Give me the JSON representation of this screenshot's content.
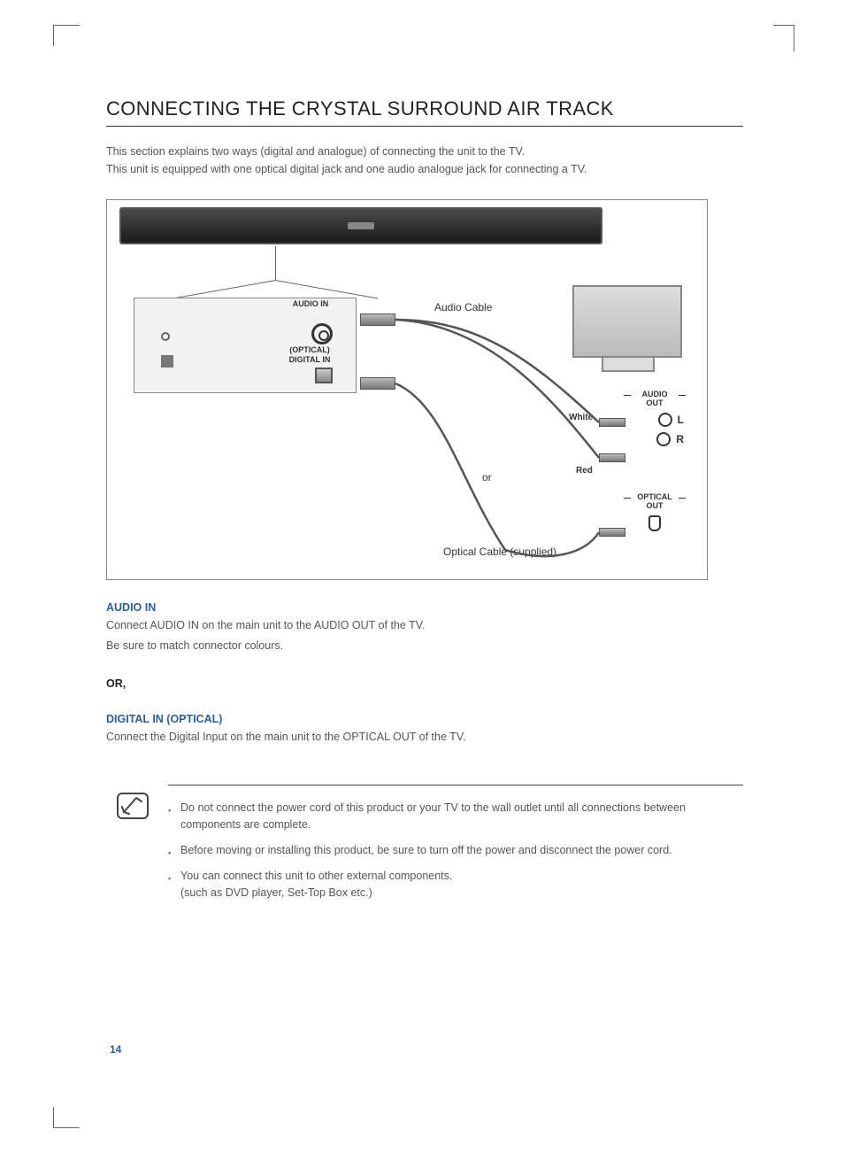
{
  "title": "CONNECTING THE CRYSTAL SURROUND AIR TRACK",
  "intro1": "This section explains two ways (digital and analogue) of connecting the unit to the TV.",
  "intro2": "This unit is equipped with one optical digital jack and one audio analogue jack for connecting a TV.",
  "diagram": {
    "audio_in": "AUDIO IN",
    "optical_digital_in_l1": "(OPTICAL)",
    "optical_digital_in_l2": "DIGITAL IN",
    "audio_cable": "Audio Cable",
    "or": "or",
    "white": "White",
    "red": "Red",
    "audio_out": "AUDIO",
    "out": "OUT",
    "L": "L",
    "R": "R",
    "optical_out": "OPTICAL",
    "optical_cable": "Optical Cable (supplied)"
  },
  "sections": {
    "audio_in_h": "AUDIO IN",
    "audio_in_b1": "Connect AUDIO IN on the main unit to the AUDIO OUT of the TV.",
    "audio_in_b2": "Be sure to match connector colours.",
    "or": "OR,",
    "digital_h": "DIGITAL IN (OPTICAL)",
    "digital_b": "Connect the Digital Input on the main unit to the OPTICAL OUT of the TV."
  },
  "notes": [
    "Do not connect the power cord of this product or your TV to the wall outlet until all connections between components are complete.",
    "Before moving or installing this product, be sure to turn off the power and disconnect the power cord.",
    "You can connect this unit to other external components.\n(such as DVD player, Set-Top Box etc.)"
  ],
  "page_number": "14"
}
